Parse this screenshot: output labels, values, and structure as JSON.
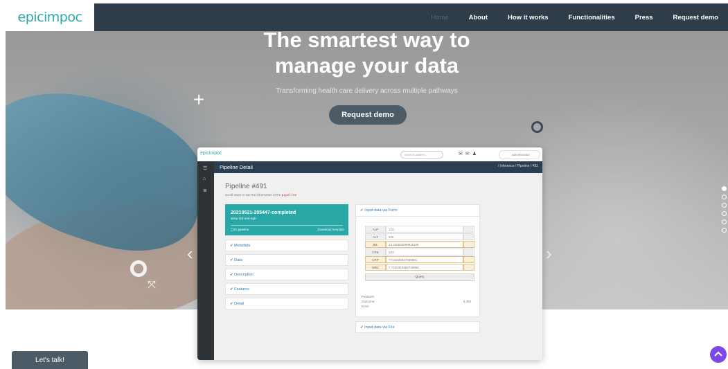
{
  "header": {
    "logo": "epicimpoc",
    "nav": [
      "Home",
      "About",
      "How it works",
      "Functionalities",
      "Press",
      "Request demo"
    ]
  },
  "hero": {
    "title_line1": "The smartest way to",
    "title_line2": "manage your data",
    "subtitle": "Transforming health care delivery across multiple pathways",
    "cta": "Request demo",
    "slide_count": 6,
    "active_slide": 1
  },
  "app": {
    "logo": "epicimpoc",
    "search_placeholder": "Search pattern...",
    "user": "administrator",
    "bar_title": "Pipeline Detail",
    "breadcrumb": "/ Inference / Pipeline / 491",
    "pipeline_title": "Pipeline #491",
    "pipeline_sub": "Scroll down to see the information of the",
    "pipeline_code": "pipeline",
    "card": {
      "title": "20210521-205447-completed",
      "subtitle": "simp-std-smt-sgb",
      "left": "CSN pipeline",
      "right": "Download template"
    },
    "sections": [
      "Metadata",
      "Data",
      "Description",
      "Features",
      "Detail"
    ],
    "form_header": "Input data via Form",
    "fields": [
      {
        "label": "ALP",
        "value": "123",
        "highlight": false
      },
      {
        "label": "ALT",
        "value": "122",
        "highlight": false
      },
      {
        "label": "BIL",
        "value": "12.235692868811505",
        "highlight": true
      },
      {
        "label": "CRE",
        "value": "123",
        "highlight": false
      },
      {
        "label": "CRP",
        "value": "77.21022547908891",
        "highlight": true
      },
      {
        "label": "WBC",
        "value": "7.7120314684739966",
        "highlight": true
      }
    ],
    "query_label": "Query",
    "results": {
      "features_label": "Features:",
      "outcome_label": "Outcome:",
      "outcome_value": "0.493",
      "error_label": "Error:"
    },
    "file_header": "Input data via File"
  },
  "footer": {
    "talk": "Let's talk!"
  }
}
